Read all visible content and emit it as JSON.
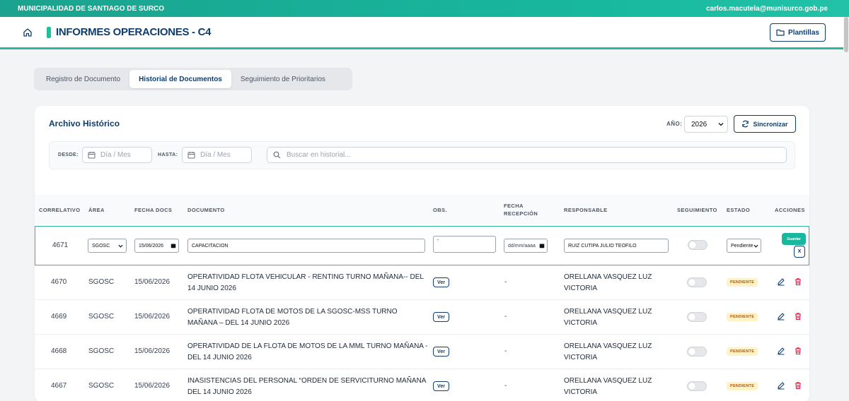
{
  "topbar": {
    "org": "MUNICIPALIDAD DE SANTIAGO DE SURCO",
    "email": "carlos.macutela@munisurco.gob.pe"
  },
  "header": {
    "title": "INFORMES OPERACIONES - C4",
    "plantillas": "Plantillas"
  },
  "tabs": [
    "Registro de Documento",
    "Historial de Documentos",
    "Seguimiento de Prioritarios"
  ],
  "archive": {
    "title": "Archivo Histórico",
    "anio_label": "AÑO:",
    "anio_value": "2026",
    "sync_label": "Sincronizar",
    "desde_label": "DESDE:",
    "hasta_label": "HASTA:",
    "date_placeholder": "Día / Mes",
    "search_placeholder": "Buscar en historial..."
  },
  "table": {
    "headers": [
      "CORRELATIVO",
      "ÁREA",
      "FECHA DOCS",
      "DOCUMENTO",
      "OBS.",
      "FECHA",
      "RECEPCIÓN",
      "RESPONSABLE",
      "SEGUIMIENTO",
      "ESTADO",
      "ACCIONES"
    ],
    "edit_row": {
      "correlativo": "4671",
      "area": "SGOSC",
      "fecha": "15/06/2026",
      "documento": "CAPACITACION",
      "obs": "-",
      "recepcion": "dd/mm/aaaa",
      "responsable": "RUIZ CUTIPA JULIO TEOFILO",
      "estado": "Pendiente",
      "guardar": "Guardar",
      "cancel": "X"
    },
    "rows": [
      {
        "correlativo": "4670",
        "area": "SGOSC",
        "fecha": "15/06/2026",
        "documento": "OPERATIVIDAD FLOTA VEHICULAR - RENTING TURNO MAÑANA-- DEL 14 JUNIO 2026",
        "ver": "Ver",
        "recepcion": "-",
        "responsable": "ORELLANA VASQUEZ LUZ VICTORIA",
        "estado": "PENDIENTE"
      },
      {
        "correlativo": "4669",
        "area": "SGOSC",
        "fecha": "15/06/2026",
        "documento": "OPERATIVIDAD FLOTA DE MOTOS DE LA SGOSC-MSS TURNO MAÑANA – DEL 14 JUNIO 2026",
        "ver": "Ver",
        "recepcion": "-",
        "responsable": "ORELLANA VASQUEZ LUZ VICTORIA",
        "estado": "PENDIENTE"
      },
      {
        "correlativo": "4668",
        "area": "SGOSC",
        "fecha": "15/06/2026",
        "documento": "OPERATIVIDAD DE LA FLOTA DE MOTOS DE LA MML TURNO MAÑANA - DEL 14 JUNIO 2026",
        "ver": "Ver",
        "recepcion": "-",
        "responsable": "ORELLANA VASQUEZ LUZ VICTORIA",
        "estado": "PENDIENTE"
      },
      {
        "correlativo": "4667",
        "area": "SGOSC",
        "fecha": "15/06/2026",
        "documento": "INASISTENCIAS DEL PERSONAL “ORDEN DE SERVICITURNO MAÑANA DEL 14 JUNIO 2026",
        "ver": "Ver",
        "recepcion": "-",
        "responsable": "ORELLANA VASQUEZ LUZ VICTORIA",
        "estado": "PENDIENTE"
      }
    ]
  },
  "colors": {
    "accent": "#18b89e",
    "navy": "#0f3d6e",
    "badge_bg": "#fef3c7",
    "badge_fg": "#b45309",
    "delete": "#e11d48"
  }
}
